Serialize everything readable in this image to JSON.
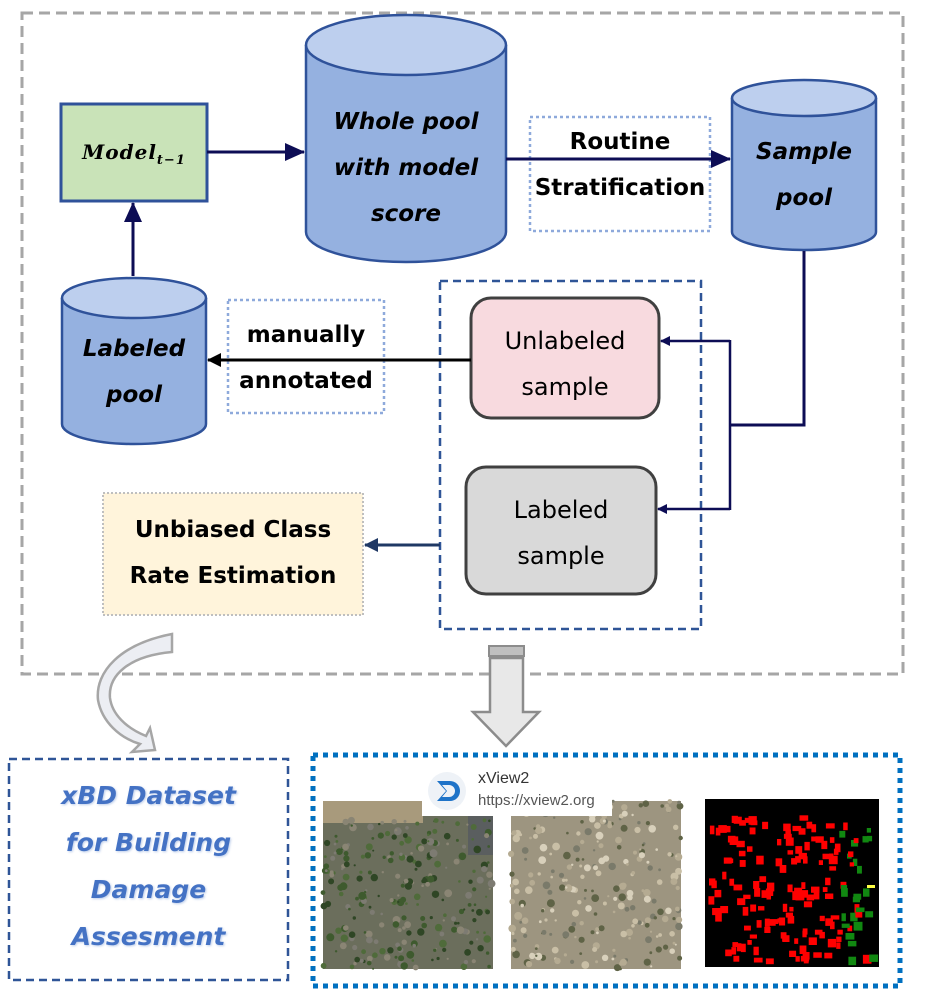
{
  "nodes": {
    "model": {
      "label": "Model",
      "subscript": "t−1",
      "fill": "#C9E3B8"
    },
    "whole_pool": {
      "lines": [
        "Whole pool",
        "with model",
        "score"
      ]
    },
    "routine": {
      "lines": [
        "Routine",
        "Stratification"
      ]
    },
    "sample_pool": {
      "lines": [
        "Sample",
        "pool"
      ]
    },
    "labeled_pool": {
      "lines": [
        "Labeled",
        "pool"
      ]
    },
    "manual": {
      "lines": [
        "manually",
        "annotated"
      ]
    },
    "unlabeled_sample": {
      "lines": [
        "Unlabeled",
        "sample"
      ],
      "fill": "#F8DADF"
    },
    "labeled_sample": {
      "lines": [
        "Labeled",
        "sample"
      ],
      "fill": "#D9D9D9"
    },
    "unbiased": {
      "lines": [
        "Unbiased Class",
        "Rate Estimation"
      ],
      "fill": "#FFF4DB"
    },
    "xbd": {
      "lines": [
        "xBD Dataset",
        "for Building",
        "Damage",
        "Assesment"
      ]
    }
  },
  "xview": {
    "title": "xView2",
    "url": "https://xview2.org"
  },
  "colors": {
    "cylinder_body": "#95B1E0",
    "cylinder_top": "#BDCFEE",
    "cylinder_stroke": "#2F529A",
    "arrow": "#0D0D55",
    "outer_border": "#A6A6A6",
    "group_border": "#2F5597",
    "images_border": "#0070C0",
    "xbd_text": "#4472C4"
  }
}
